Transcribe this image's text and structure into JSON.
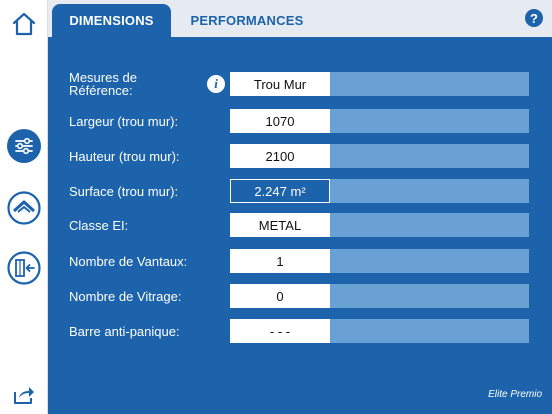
{
  "tabs": [
    {
      "label": "DIMENSIONS",
      "active": true
    },
    {
      "label": "PERFORMANCES",
      "active": false
    }
  ],
  "help_label": "?",
  "info_label": "i",
  "rows": [
    {
      "label_line1": "Mesures de",
      "label_line2": "Référence:",
      "value": "Trou Mur"
    },
    {
      "label": "Largeur (trou mur):",
      "value": "1070"
    },
    {
      "label": "Hauteur (trou mur):",
      "value": "2100"
    },
    {
      "label": "Surface (trou mur):",
      "value": "2.247 m²"
    },
    {
      "label": "Classe EI:",
      "value": "METAL"
    },
    {
      "label": "Nombre de Vantaux:",
      "value": "1"
    },
    {
      "label": "Nombre de Vitrage:",
      "value": "0"
    },
    {
      "label": "Barre anti-panique:",
      "value": "- - -"
    }
  ],
  "brand": "Elite Premio",
  "colors": {
    "primary": "#1c63ac",
    "light_bar": "#6aa1d4",
    "topbar": "#e6ebf1",
    "white": "#ffffff"
  },
  "icons": [
    "home-icon",
    "sliders-icon",
    "roof-icon",
    "door-exit-icon",
    "share-icon",
    "help-icon",
    "info-icon"
  ]
}
